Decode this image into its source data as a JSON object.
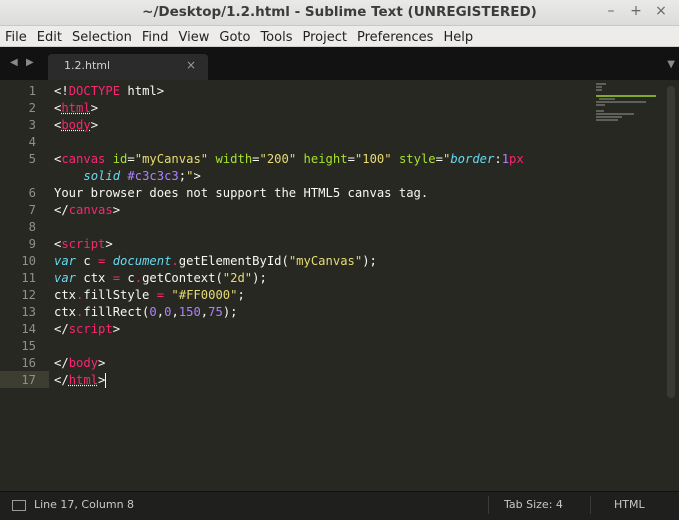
{
  "window": {
    "title": "~/Desktop/1.2.html - Sublime Text (UNREGISTERED)"
  },
  "menu": [
    "File",
    "Edit",
    "Selection",
    "Find",
    "View",
    "Goto",
    "Tools",
    "Project",
    "Preferences",
    "Help"
  ],
  "tab": {
    "label": "1.2.html",
    "close": "×"
  },
  "line_numbers": [
    "1",
    "2",
    "3",
    "4",
    "5",
    "",
    "6",
    "7",
    "8",
    "9",
    "10",
    "11",
    "12",
    "13",
    "14",
    "15",
    "16",
    "17"
  ],
  "status": {
    "position": "Line 17, Column 8",
    "tab_size": "Tab Size: 4",
    "syntax": "HTML"
  },
  "colors": {
    "editor_bg": "#272822",
    "tag": "#f92672",
    "attr": "#a6e22e",
    "string": "#e6db74",
    "keyword": "#66d9ef",
    "number": "#ae81ff"
  }
}
